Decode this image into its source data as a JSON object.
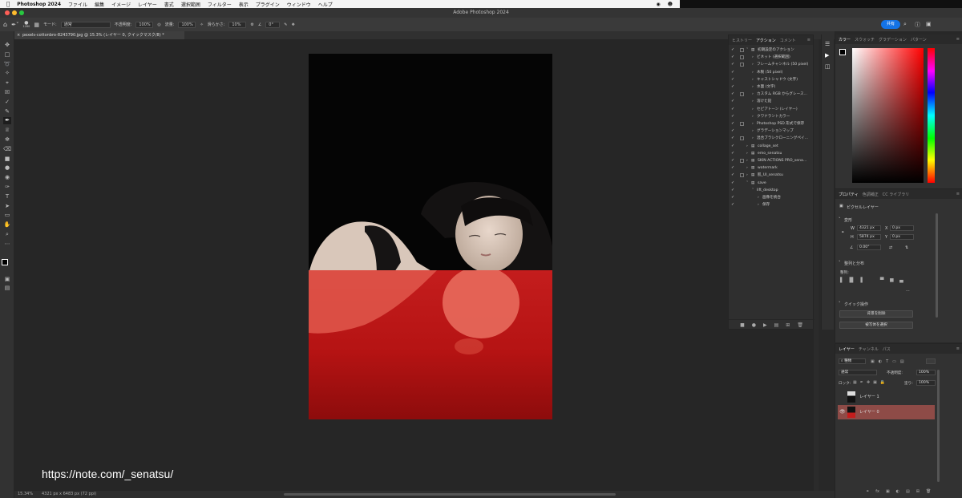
{
  "menubar": {
    "apple_icon": "apple-icon",
    "app_name": "Photoshop 2024",
    "items": [
      "ファイル",
      "編集",
      "イメージ",
      "レイヤー",
      "書式",
      "選択範囲",
      "フィルター",
      "表示",
      "プラグイン",
      "ウィンドウ",
      "ヘルプ"
    ]
  },
  "window": {
    "title": "Adobe Photoshop 2024"
  },
  "options_bar": {
    "brush_size": "1280",
    "mode_label": "モード:",
    "mode_value": "通常",
    "opacity_label": "不透明度:",
    "opacity_value": "100%",
    "flow_label": "流量:",
    "flow_value": "100%",
    "smoothing_label": "滑らかさ:",
    "smoothing_value": "10%",
    "angle_value": "0°",
    "share_label": "共有"
  },
  "document": {
    "tab_title": "pexels-cottonbro-8243790.jpg @ 15.3% (レイヤー 0, クイックマスク/8) *",
    "mask_color": "#c41d1d"
  },
  "status": {
    "zoom": "15.34%",
    "doc_size": "4321 px x 6483 px (72 ppi)"
  },
  "watermark": "https://note.com/_senatsu/",
  "actions_panel": {
    "tabs": [
      "ヒストリー",
      "アクション",
      "コメント"
    ],
    "active_tab": "アクション",
    "rows": [
      {
        "label": "初期設定のアクション",
        "indent": 1,
        "type": "folder",
        "open": true,
        "box": true
      },
      {
        "label": "ビネット (選択範囲)",
        "indent": 2,
        "type": "action",
        "box": true
      },
      {
        "label": "フレームチャンネル (50 pixel)",
        "indent": 2,
        "type": "action",
        "box": true
      },
      {
        "label": "木製 (50 pixel)",
        "indent": 2,
        "type": "action",
        "box": false
      },
      {
        "label": "キャストシャドウ (文字)",
        "indent": 2,
        "type": "action",
        "box": false
      },
      {
        "label": "水面 (文字)",
        "indent": 2,
        "type": "action",
        "box": false
      },
      {
        "label": "カスタム RGB からグレース...",
        "indent": 2,
        "type": "action",
        "box": true
      },
      {
        "label": "溶けた鉛",
        "indent": 2,
        "type": "action",
        "box": false
      },
      {
        "label": "セピアトーン (レイヤー)",
        "indent": 2,
        "type": "action",
        "box": false
      },
      {
        "label": "クワドラントカラー",
        "indent": 2,
        "type": "action",
        "box": false
      },
      {
        "label": "Photoshop PSD 形式で保存",
        "indent": 2,
        "type": "action",
        "box": true
      },
      {
        "label": "グラデーションマップ",
        "indent": 2,
        "type": "action",
        "box": false
      },
      {
        "label": "混合ブラシクローニングペイ...",
        "indent": 2,
        "type": "action",
        "box": true
      },
      {
        "label": "collage_set",
        "indent": 1,
        "type": "folder",
        "box": false
      },
      {
        "label": "emo_senatsu",
        "indent": 1,
        "type": "folder",
        "box": false
      },
      {
        "label": "SKIN ACTIONS PRO_sena...",
        "indent": 1,
        "type": "folder",
        "box": true
      },
      {
        "label": "watermark",
        "indent": 1,
        "type": "folder",
        "box": false
      },
      {
        "label": "肌_UI_senatsu",
        "indent": 1,
        "type": "folder",
        "box": true
      },
      {
        "label": "save",
        "indent": 1,
        "type": "folder",
        "open": true,
        "box": false
      },
      {
        "label": "lift_desktop",
        "indent": 2,
        "type": "action",
        "open": true,
        "box": false
      },
      {
        "label": "画像を統合",
        "indent": 3,
        "type": "step",
        "box": false
      },
      {
        "label": "保存",
        "indent": 3,
        "type": "step",
        "box": false
      }
    ]
  },
  "color_panel": {
    "tabs": [
      "カラー",
      "スウォッチ",
      "グラデーション",
      "パターン"
    ]
  },
  "properties_panel": {
    "tabs": [
      "プロパティ",
      "色調補正",
      "CC ライブラリ"
    ],
    "layer_type": "ピクセルレイヤー",
    "transform_heading": "変形",
    "w": "4321 px",
    "h": "5874 px",
    "x": "0 px",
    "y": "0 px",
    "angle": "0.00°",
    "align_heading": "整列と分布",
    "align_label": "整列:",
    "quick_heading": "クイック操作",
    "btn_remove_bg": "背景を削除",
    "btn_select_subject": "被写体を選択"
  },
  "layers_panel": {
    "tabs": [
      "レイヤー",
      "チャンネル",
      "パス"
    ],
    "filter": "種類",
    "blend_mode": "通常",
    "opacity_label": "不透明度:",
    "opacity_value": "100%",
    "lock_label": "ロック:",
    "fill_label": "塗り:",
    "fill_value": "100%",
    "layers": [
      {
        "name": "レイヤー 1",
        "visible": false,
        "selected": false
      },
      {
        "name": "レイヤー 0",
        "visible": true,
        "selected": true
      }
    ],
    "selected_color": "#8e4b47"
  }
}
